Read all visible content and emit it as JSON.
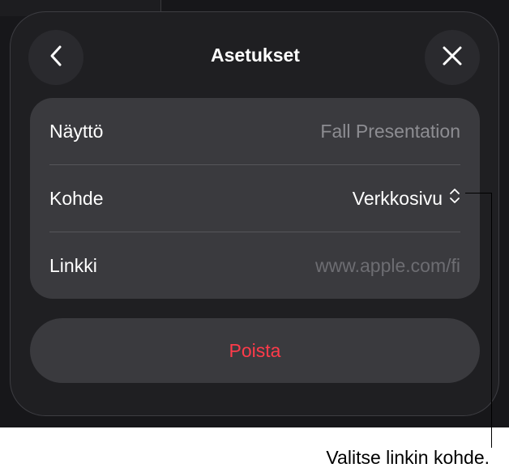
{
  "header": {
    "title": "Asetukset",
    "back_icon": "chevron-left-icon",
    "close_icon": "close-icon"
  },
  "settings": {
    "rows": [
      {
        "label": "Näyttö",
        "value": "Fall Presentation"
      },
      {
        "label": "Kohde",
        "value": "Verkkosivu",
        "icon": "up-down-chevron-icon"
      },
      {
        "label": "Linkki",
        "value": "www.apple.com/fi"
      }
    ]
  },
  "actions": {
    "delete_label": "Poista"
  },
  "callout": {
    "text": "Valitse linkin kohde."
  },
  "colors": {
    "background": "#17171a",
    "sheet": "#1f1f22",
    "group": "#3a3a3e",
    "destructive": "#ff3b4a",
    "secondary_text": "#8d8d92"
  }
}
